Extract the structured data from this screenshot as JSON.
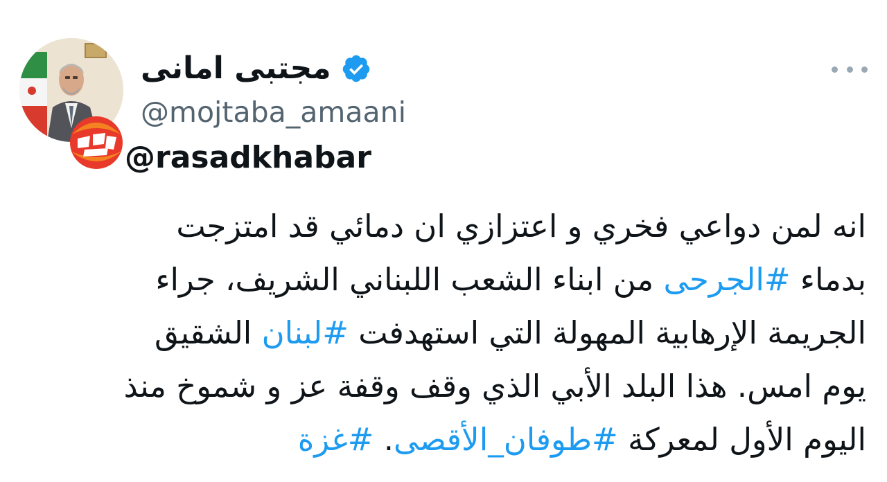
{
  "author": {
    "display_name": "مجتبی امانی",
    "handle": "@mojtaba_amaani",
    "verified": true
  },
  "watermark": {
    "logo_text": "رصد",
    "handle": "@rasadkhabar"
  },
  "more_menu": {
    "icon": "more-horizontal-icon"
  },
  "body": {
    "line1": {
      "text": "انه لمن دواعي فخري و اعتزازي ان دمائي قد امتزجت"
    },
    "line2": {
      "pre": "بدماء ",
      "tag": "#الجرحى",
      "post": " من ابناء الشعب اللبناني الشريف، جراء"
    },
    "line3": {
      "pre": "الجريمة الإرهابية المهولة التي استهدفت ",
      "tag": "#لبنان",
      "post": " الشقيق"
    },
    "line4": {
      "text": "يوم امس. هذا البلد الأبي الذي وقف وقفة عز و شموخ منذ"
    },
    "line5": {
      "pre": "اليوم الأول لمعركة ",
      "tag": "#طوفان_الأقصى",
      "mid": ". ",
      "tag2": "#غزة"
    }
  },
  "colors": {
    "text": "#0f1419",
    "secondary": "#536471",
    "hashtag": "#1d9bf0",
    "verified_badge": "#1d9bf0",
    "watermark_red": "#e8392a",
    "watermark_orange": "#f58220"
  }
}
